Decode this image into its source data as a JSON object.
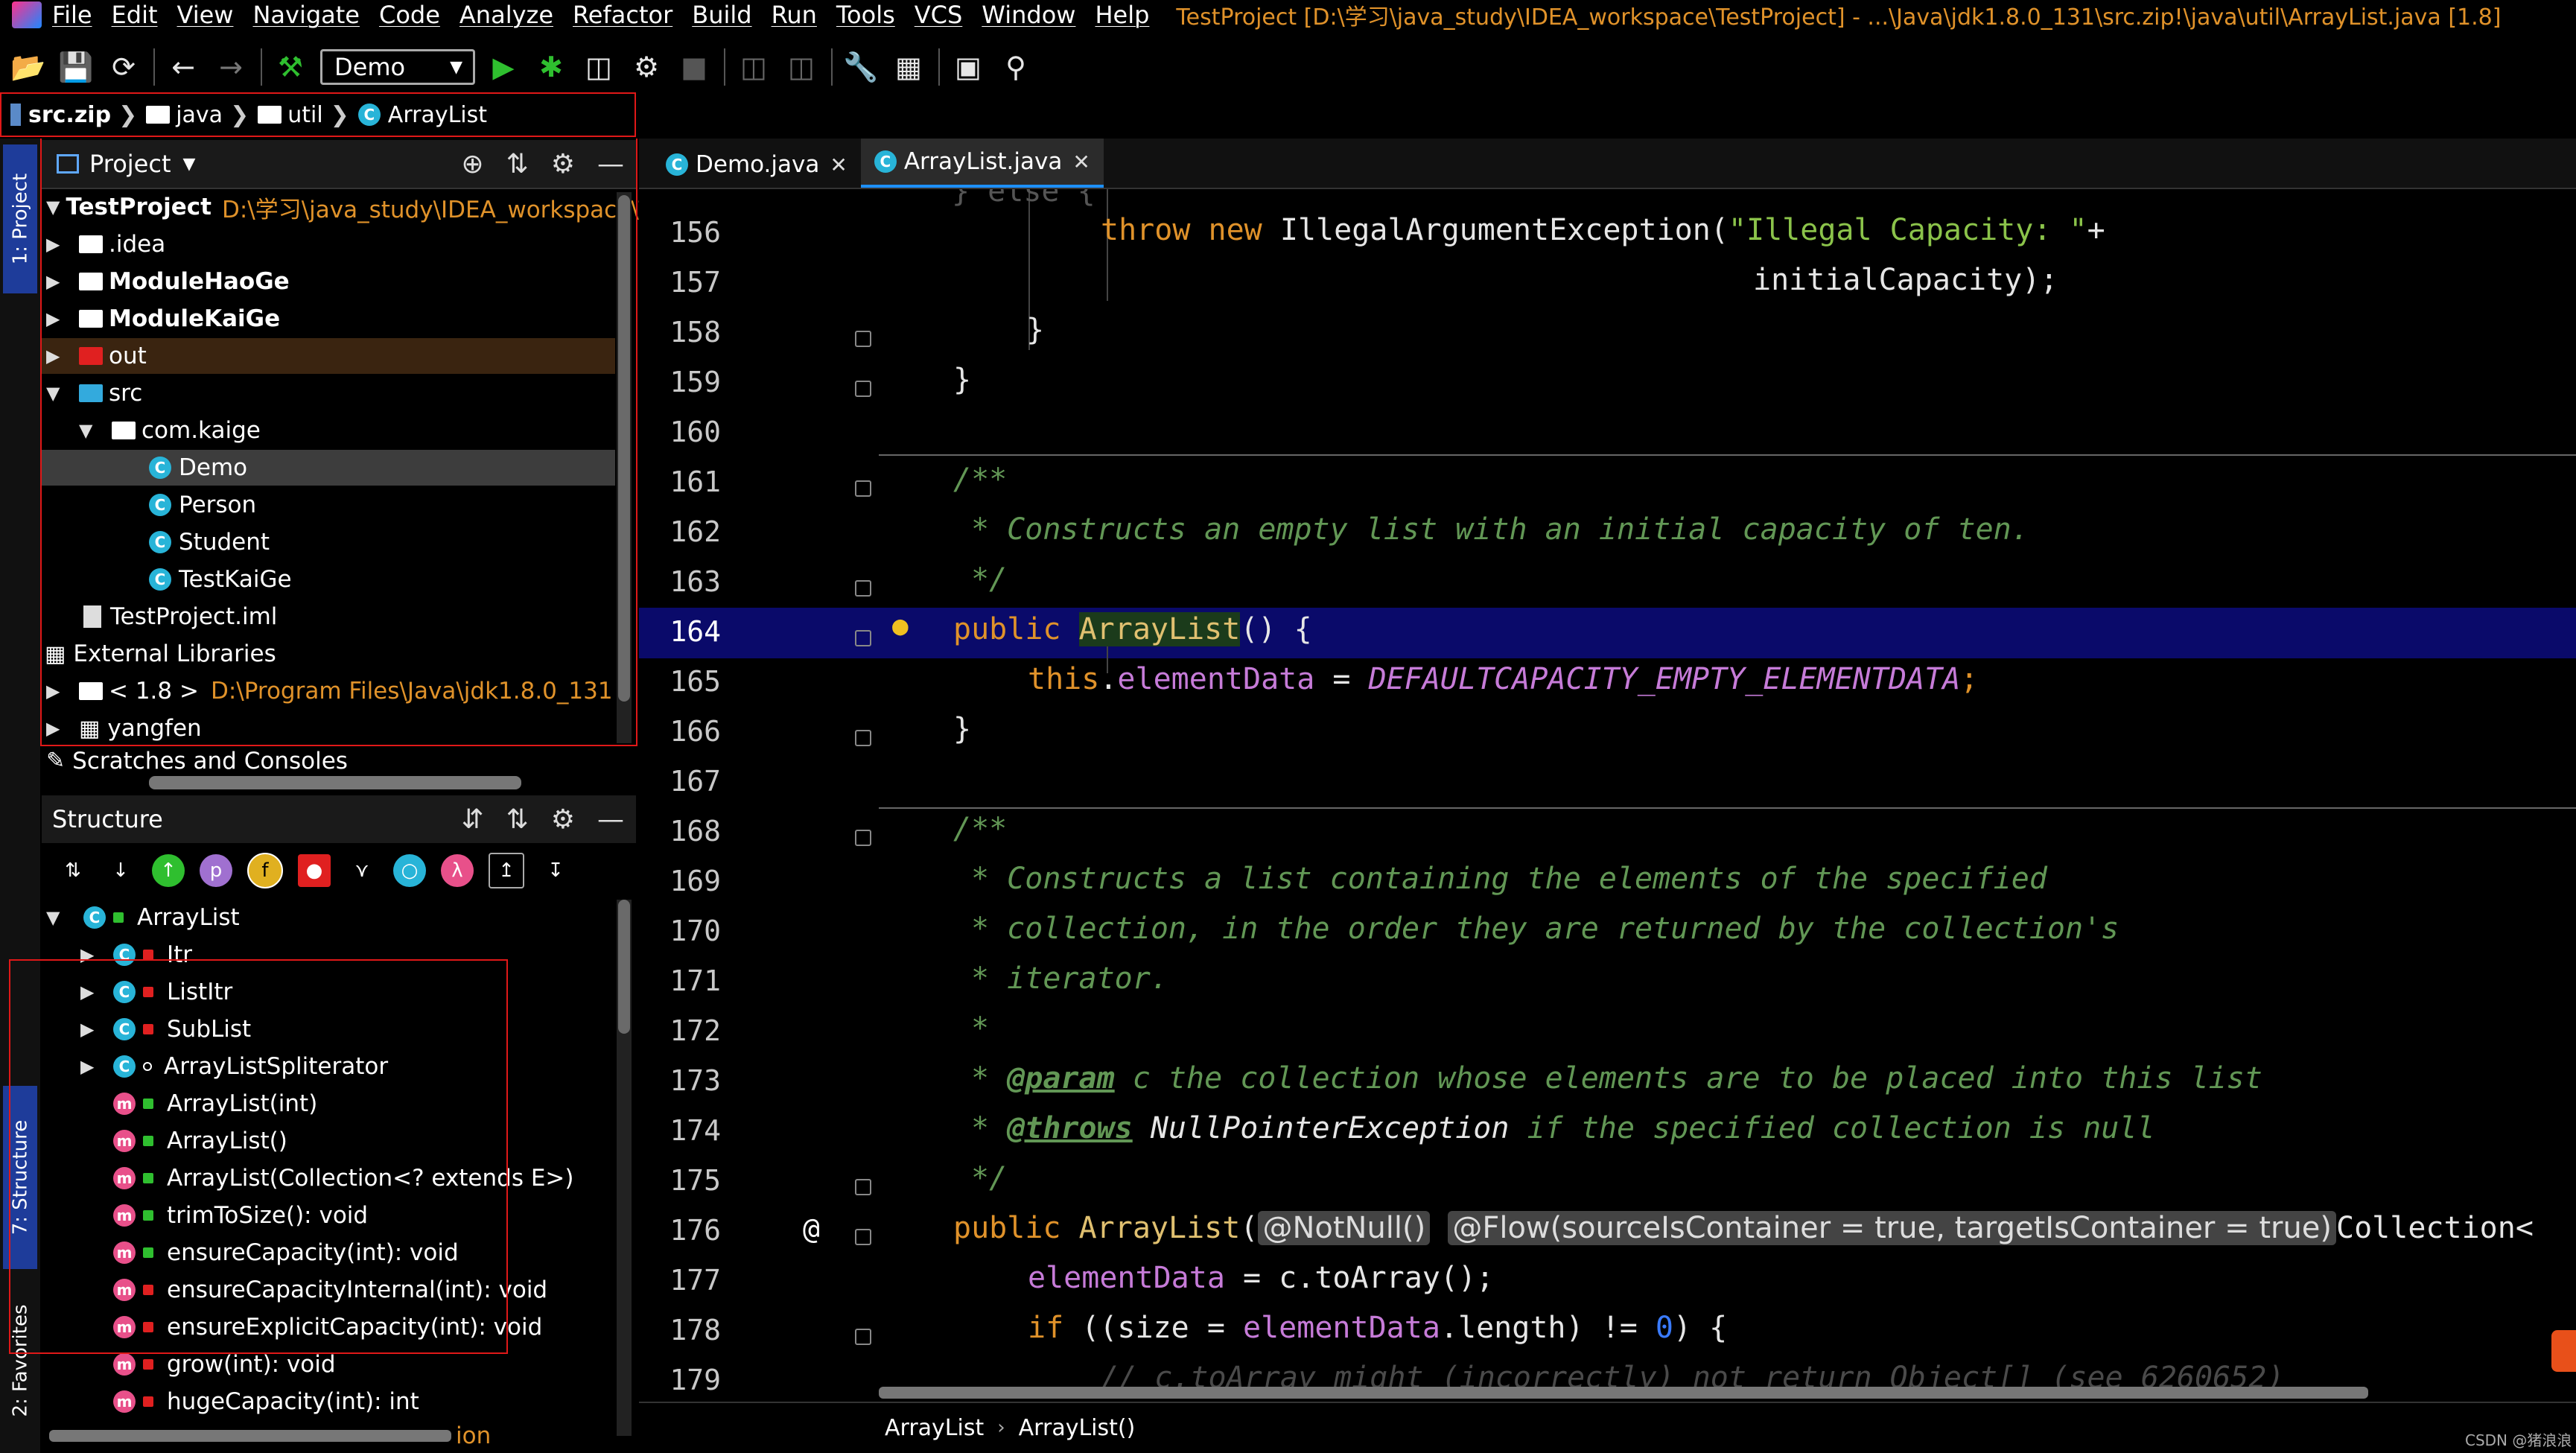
{
  "menubar": {
    "items": [
      "File",
      "Edit",
      "View",
      "Navigate",
      "Code",
      "Analyze",
      "Refactor",
      "Build",
      "Run",
      "Tools",
      "VCS",
      "Window",
      "Help"
    ],
    "window_title": "TestProject [D:\\学习\\java_study\\IDEA_workspace\\TestProject] - ...\\Java\\jdk1.8.0_131\\src.zip!\\java\\util\\ArrayList.java [1.8]"
  },
  "toolbar": {
    "run_config": "Demo"
  },
  "breadcrumb": [
    "src.zip",
    "java",
    "util",
    "ArrayList"
  ],
  "left_stripe": {
    "project_tab": "1: Project",
    "structure_tab": "7: Structure",
    "favorites_tab": "2: Favorites"
  },
  "project_panel": {
    "title": "Project",
    "tree": [
      {
        "label": "TestProject",
        "path": "D:\\学习\\java_study\\IDEA_workspace\\T",
        "bold": true
      },
      {
        "label": ".idea"
      },
      {
        "label": "ModuleHaoGe",
        "bold": true
      },
      {
        "label": "ModuleKaiGe",
        "bold": true
      },
      {
        "label": "out"
      },
      {
        "label": "src"
      },
      {
        "label": "com.kaige"
      },
      {
        "label": "Demo"
      },
      {
        "label": "Person"
      },
      {
        "label": "Student"
      },
      {
        "label": "TestKaiGe"
      },
      {
        "label": "TestProject.iml"
      },
      {
        "label": "External Libraries"
      },
      {
        "label": "< 1.8 >",
        "path": "D:\\Program Files\\Java\\jdk1.8.0_131"
      },
      {
        "label": "yangfen"
      },
      {
        "label": "Scratches and Consoles"
      }
    ]
  },
  "structure_panel": {
    "title": "Structure",
    "tree": [
      "ArrayList",
      "Itr",
      "ListItr",
      "SubList",
      "ArrayListSpliterator",
      "ArrayList(int)",
      "ArrayList()",
      "ArrayList(Collection<? extends E>)",
      "trimToSize(): void",
      "ensureCapacity(int): void",
      "ensureCapacityInternal(int): void",
      "ensureExplicitCapacity(int): void",
      "grow(int): void",
      "hugeCapacity(int): int"
    ],
    "partial_label": "ion"
  },
  "editor_tabs": [
    {
      "label": "Demo.java",
      "active": false
    },
    {
      "label": "ArrayList.java",
      "active": true
    }
  ],
  "editor": {
    "line_numbers": [
      "156",
      "157",
      "158",
      "159",
      "160",
      "161",
      "162",
      "163",
      "164",
      "165",
      "166",
      "167",
      "168",
      "169",
      "170",
      "171",
      "172",
      "173",
      "174",
      "175",
      "176",
      "177",
      "178",
      "179"
    ],
    "current_line": "164",
    "code": {
      "l156_kw1": "throw",
      "l156_kw2": "new",
      "l156_cls": "IllegalArgumentException(",
      "l156_str": "\"Illegal Capacity: \"",
      "l156_plus": "+",
      "l157": "initialCapacity);",
      "l158": "}",
      "l159": "}",
      "l161": "/**",
      "l162": "* Constructs an empty list with an initial capacity of ten.",
      "l163": "*/",
      "l164_kw": "public",
      "l164_fn": "ArrayList",
      "l164_rest": "() {",
      "l165_kw": "this",
      "l165_dot": ".",
      "l165_field": "elementData",
      "l165_eq": " = ",
      "l165_const": "DEFAULTCAPACITY_EMPTY_ELEMENTDATA",
      "l165_semi": ";",
      "l166": "}",
      "l168": "/**",
      "l169": "* Constructs a list containing the elements of the specified",
      "l170": "* collection, in the order they are returned by the collection's",
      "l171": "* iterator.",
      "l172": "*",
      "l173_star": "* ",
      "l173_tag": "@param",
      "l173_rest": " c the collection whose elements are to be placed into this list",
      "l174_star": "* ",
      "l174_tag": "@throws",
      "l174_cls": " NullPointerException",
      "l174_rest": " if the specified collection is null",
      "l175": "*/",
      "l176_kw": "public",
      "l176_fn": "ArrayList",
      "l176_paren": "(",
      "l176_ann1": "@NotNull()",
      "l176_ann2": "@Flow(sourceIsContainer = true, targetIsContainer = true)",
      "l176_rest": "Collection<",
      "l177_field": "elementData",
      "l177_rest": " = c.toArray();",
      "l178_kw": "if",
      "l178_a": " ((size = ",
      "l178_field": "elementData",
      "l178_b": ".length) != ",
      "l178_num": "0",
      "l178_c": ") {",
      "l179": "// c.toArray might (incorrectly) not return Object[] (see 6260652)"
    },
    "gutter_at": "@"
  },
  "statusbar": {
    "crumb1": "ArrayList",
    "crumb2": "ArrayList()"
  },
  "watermark": "CSDN @猪浪浪"
}
